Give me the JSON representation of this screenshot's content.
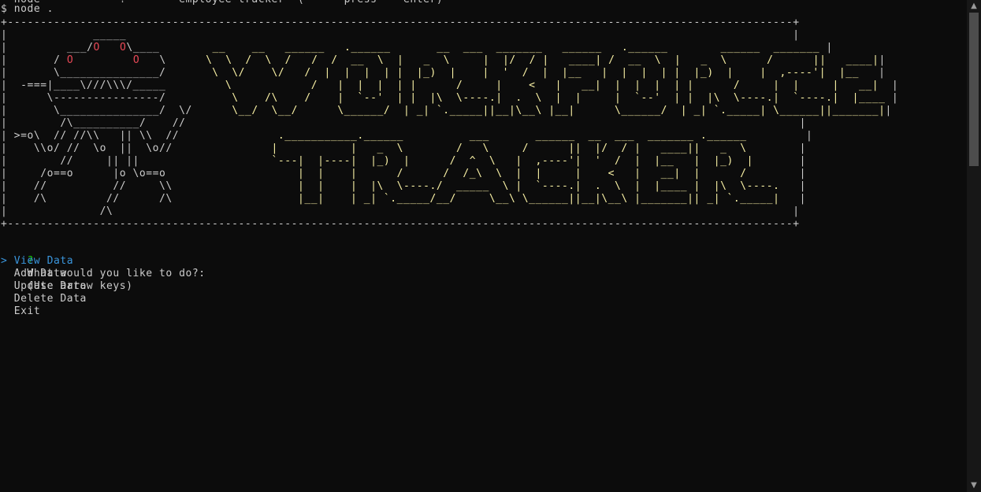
{
  "terminal": {
    "top_cutoff_line": "  node            ?        employee tracker  (      press    enter)",
    "command": "$ node .",
    "box_top": "+-----------------------------------------------------------------------------------------------------------------------+",
    "box_bottom": "+-----------------------------------------------------------------------------------------------------------------------+",
    "banner_rows": [
      {
        "robot": "|             _____            ",
        "title": "                                                                                         |"
      },
      {
        "robot": "|         ___/O   O\\____       ",
        "title": " __    __   ______   .______       __  ___  _______   ______   .______        ______  _______ |"
      },
      {
        "robot": "|       / O         O   \\      ",
        "title": "\\  \\  /  \\  /   /  /  __  \\  |   _  \\     |  |/  / |   ____| /  __  \\  |   _  \\      /      ||   ____||"
      },
      {
        "robot": "|       \\_______________/      ",
        "title": " \\  \\/    \\/   /  |  |  |  | |  |_)  |    |  '  /  |  |__   |  |  |  | |  |_)  |    |  ,----'|  |__   |"
      },
      {
        "robot": "|  -===|____\\///\\\\\\/_____       ",
        "title": "  \\            /   |  |  |  | |      /     |    <   |   __|  |  |  |  | |      /     |  |     |   __|  |"
      },
      {
        "robot": "|      \\----------------/       ",
        "title": "   \\    /\\    /    |  `--'  | |  |\\  \\----.|  .  \\  |  |     |  `--'  | |  |\\  \\----.|  `----.|  |____ |"
      },
      {
        "robot": "|       \\_______________/  \\/  ",
        "title": "    \\__/  \\__/      \\______/  | _| `._____||__|\\__\\ |__|      \\______/  | _| `._____| \\______||_______||"
      },
      {
        "robot": "|        /\\__________/    //   ",
        "title": "                                                                                          |"
      },
      {
        "robot": "| >=o\\  // //\\\\   || \\\\  //     ",
        "title": "          .___________.______          ___       ______  __  ___  _______ .______         |"
      },
      {
        "robot": "|    \\\\o/ //  \\o  ||  \\o//     ",
        "title": "          |           |   _  \\        /   \\     /      ||  |/  / |   ____||   _  \\        |"
      },
      {
        "robot": "|        //     || ||          ",
        "title": "          `---|  |----|  |_)  |      /  ^  \\   |  ,----'|  '  /  |  |__   |  |_)  |       |"
      },
      {
        "robot": "|     /o==o      |o \\o==o      ",
        "title": "              |  |    |      /      /  /_\\  \\  |  |     |    <   |   __|  |      /        |"
      },
      {
        "robot": "|    //          //     \\\\     ",
        "title": "              |  |    |  |\\  \\----./  _____  \\ |  `----.|  .  \\  |  |____ |  |\\  \\----.   |"
      },
      {
        "robot": "|    /\\         //      /\\     ",
        "title": "              |__|    | _| `._____/__/     \\__\\ \\______||__|\\__\\ |_______|| _| `._____|   |"
      },
      {
        "robot": "|              /\\              ",
        "title": "                                                                                         |"
      }
    ],
    "prompt": {
      "mark": "?",
      "question": "What would you like to do?:",
      "hint": "(Use arrow keys)"
    },
    "menu": {
      "pointer": ">",
      "options": [
        "View Data",
        "Add Data",
        "Update Data",
        "Delete Data",
        "Exit"
      ],
      "selected_index": 0
    },
    "colors": {
      "background": "#0c0c0c",
      "text": "#cccccc",
      "title_art": "#f9f1a5",
      "robot_eyes": "#e74856",
      "prompt_mark": "#16c60c",
      "selected": "#3a96dd"
    }
  },
  "scrollbar": {
    "up_icon": "▲",
    "down_icon": "▼"
  }
}
